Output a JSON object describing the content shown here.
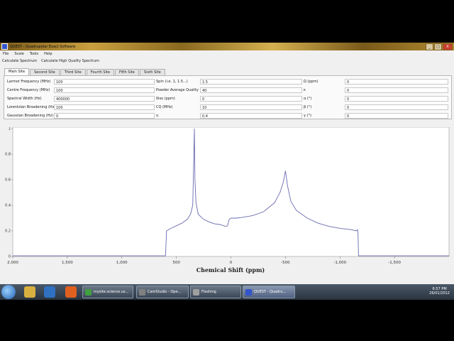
{
  "window": {
    "title": "QUEST - Quadrupolar Exact Software",
    "buttons": [
      "_",
      "□",
      "X"
    ]
  },
  "menu": [
    "File",
    "Scale",
    "Tools",
    "Help"
  ],
  "toolbar": [
    "Calculate Spectrum",
    "Calculate High Quality Spectrum"
  ],
  "tabs": [
    "Main Site",
    "Second Site",
    "Third Site",
    "Fourth Site",
    "Fifth Site",
    "Sixth Site"
  ],
  "params": {
    "col1": [
      {
        "label": "Larmor Frequency (MHz)",
        "value": "100"
      },
      {
        "label": "Centre Frequency (MHz)",
        "value": "100"
      },
      {
        "label": "Spectral Width (Hz)",
        "value": "400000"
      },
      {
        "label": "Lorentzian Broadening (Hz)",
        "value": "100"
      },
      {
        "label": "Gaussian Broadening (Hz)",
        "value": "0"
      }
    ],
    "col2": [
      {
        "label": "Spin (i.e. 1, 1.5...)",
        "value": "1.5"
      },
      {
        "label": "Powder Average Quality",
        "value": "40"
      },
      {
        "label": "δiso (ppm)",
        "value": "0"
      },
      {
        "label": "CQ (MHz)",
        "value": "10"
      },
      {
        "label": "η",
        "value": "0.4"
      }
    ],
    "col3": [
      {
        "label": "Ω (ppm)",
        "value": "0"
      },
      {
        "label": "κ",
        "value": "0"
      },
      {
        "label": "α (°)",
        "value": "0"
      },
      {
        "label": "β (°)",
        "value": "0"
      },
      {
        "label": "γ (°)",
        "value": "0"
      }
    ]
  },
  "chart_data": {
    "type": "line",
    "xlabel": "Chemical Shift (ppm)",
    "xlim": [
      2000,
      -2000
    ],
    "xticks": [
      "2,000",
      "1,500",
      "1,000",
      "500",
      "0",
      "-500",
      "-1,000",
      "-1,500"
    ],
    "xtick_values": [
      2000,
      1500,
      1000,
      500,
      0,
      -500,
      -1000,
      -1500
    ],
    "ylim": [
      0,
      1
    ],
    "yticks": [
      "0",
      "0.2",
      "0.4",
      "0.6",
      "0.8",
      "1"
    ],
    "ytick_values": [
      0,
      0.2,
      0.4,
      0.6,
      0.8,
      1
    ],
    "line_color": "#6a6ab0",
    "series": [
      {
        "x": [
          2000,
          600,
          590,
          580,
          550,
          500,
          450,
          400,
          370,
          350,
          345,
          335,
          330,
          320,
          300,
          250,
          200,
          150,
          100,
          50,
          30,
          20,
          10,
          0,
          -50,
          -100,
          -200,
          -300,
          -400,
          -450,
          -480,
          -500,
          -520,
          -550,
          -600,
          -700,
          -800,
          -900,
          -1000,
          -1100,
          -1150,
          -1160,
          -1165,
          -1170,
          -1180,
          -1200,
          -2000
        ],
        "y": [
          0.005,
          0.005,
          0.2,
          0.205,
          0.22,
          0.24,
          0.26,
          0.29,
          0.33,
          0.4,
          0.6,
          1.0,
          0.6,
          0.42,
          0.33,
          0.29,
          0.27,
          0.255,
          0.25,
          0.235,
          0.24,
          0.28,
          0.295,
          0.3,
          0.3,
          0.305,
          0.32,
          0.35,
          0.42,
          0.5,
          0.58,
          0.67,
          0.55,
          0.43,
          0.36,
          0.3,
          0.26,
          0.235,
          0.22,
          0.21,
          0.2,
          0.21,
          0.195,
          0.005,
          0.005,
          0.005,
          0.005
        ]
      }
    ]
  },
  "taskbar": {
    "tasks": [
      "mysite.science.us...",
      "CamStudio - Ope...",
      "Flashing",
      "QUEST - Quadru..."
    ],
    "clock": {
      "time": "6:57 PM",
      "date": "26/01/2012"
    }
  }
}
